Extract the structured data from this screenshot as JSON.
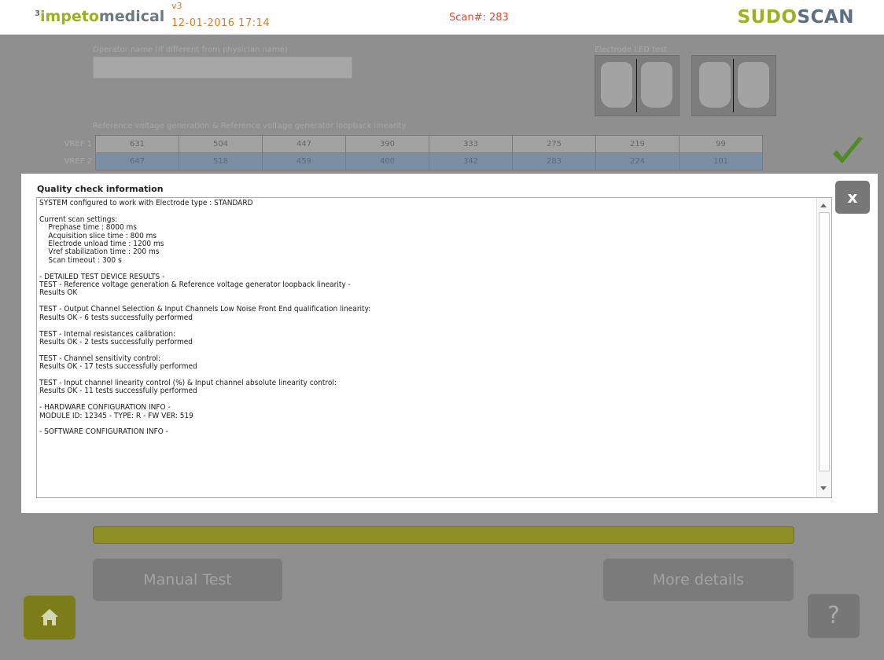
{
  "header": {
    "brand_superscript": "3",
    "brand_part1": "impeto",
    "brand_part2": "medical",
    "version": "v3",
    "datetime": "12-01-2016 17:14",
    "scan_label": "Scan#: 283",
    "product_part1": "SUDO",
    "product_part2": "SCAN"
  },
  "background": {
    "operator_label": "Operator name (if different from physician name)",
    "operator_value": "",
    "led_label": "Electrode LED test",
    "ref_label": "Reference voltage generation & Reference voltage generator loopback linearity",
    "vref_rows": [
      {
        "label": "VREF 1",
        "values": [
          "631",
          "504",
          "447",
          "390",
          "333",
          "275",
          "219",
          "99"
        ]
      },
      {
        "label": "VREF 2",
        "values": [
          "647",
          "518",
          "459",
          "400",
          "342",
          "283",
          "224",
          "101"
        ]
      }
    ],
    "progress_fraction": 1.0,
    "manual_test_label": "Manual Test",
    "more_details_label": "More details",
    "help_label": "?"
  },
  "modal": {
    "title": "Quality check information",
    "close_label": "x",
    "text": "SYSTEM configured to work with Electrode type : STANDARD\n\nCurrent scan settings:\n    Prephase time : 8000 ms\n    Acquisition slice time : 800 ms\n    Electrode unload time : 1200 ms\n    Vref stabilization time : 200 ms\n    Scan timeout : 300 s\n\n- DETAILED TEST DEVICE RESULTS -\nTEST - Reference voltage generation & Reference voltage generator loopback linearity -\nResults OK\n\nTEST - Output Channel Selection & Input Channels Low Noise Front End qualification linearity:\nResults OK - 6 tests successfully performed\n\nTEST - Internal resistances calibration:\nResults OK - 2 tests successfully performed\n\nTEST - Channel sensitivity control:\nResults OK - 17 tests successfully performed\n\nTEST - Input channel linearity control (%) & Input channel absolute linearity control:\nResults OK - 11 tests successfully performed\n\n- HARDWARE CONFIGURATION INFO -\nMODULE ID: 12345 - TYPE: R - FW VER: 519\n\n- SOFTWARE CONFIGURATION INFO -"
  },
  "colors": {
    "accent_green": "#9bb21d",
    "accent_orange": "#d87c22",
    "scan_red": "#e0482b",
    "check_green": "#4e8b22"
  }
}
